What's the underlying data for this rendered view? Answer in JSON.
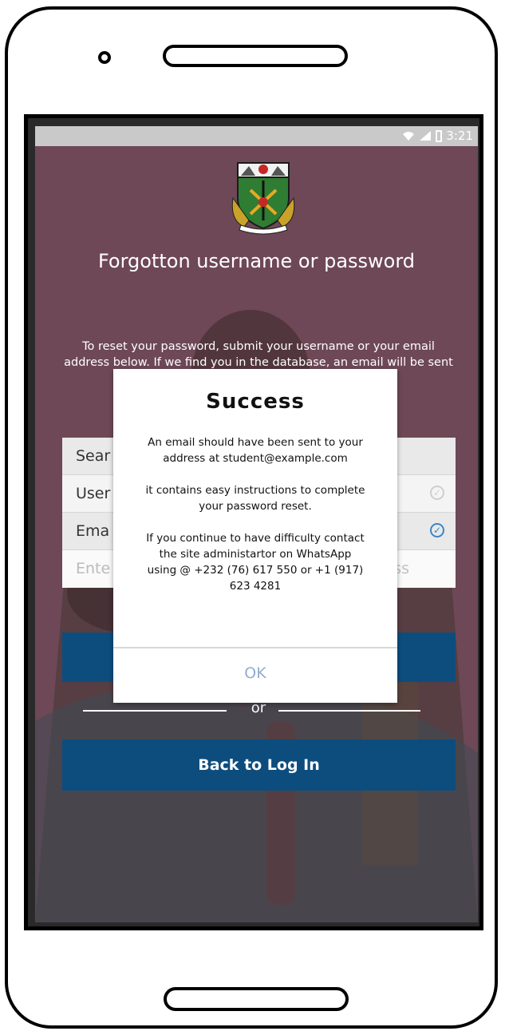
{
  "status_bar": {
    "time": "3:21"
  },
  "page": {
    "title": "Forgotton username or password",
    "intro": "To reset your password, submit your username or your email address below. If we find you in the database, an email will be sent to your email address, with"
  },
  "form": {
    "search_label": "Sear",
    "username_label": "User",
    "email_label": "Ema",
    "input_placeholder": "Ente",
    "input_suffix": "ss"
  },
  "actions": {
    "or_label": "or",
    "back_label": "Back to Log In"
  },
  "dialog": {
    "title": "Success",
    "line1": "An email should have been sent to your address at student@example.com",
    "line2": "it contains easy instructions to complete your password reset.",
    "line3": "If you continue to have difficulty contact the site administartor on WhatsApp using @ +232 (76) 617 550 or +1 (917) 623 4281",
    "ok_label": "OK"
  },
  "colors": {
    "screen_bg": "#6e4856",
    "button_bg": "#0c4d7e",
    "status_bar_bg": "#c9c9c9",
    "check_active": "#3b86c8"
  }
}
